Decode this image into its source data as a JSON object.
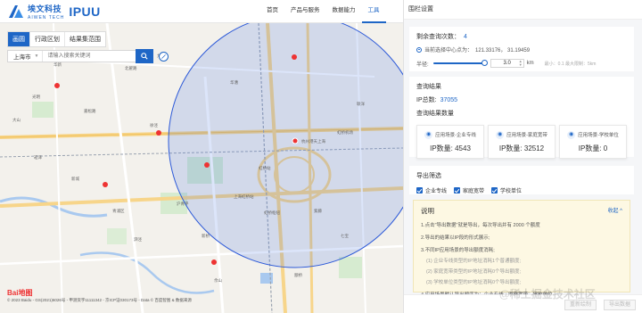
{
  "brand": {
    "name_cn": "埃文科技",
    "name_en": "AIWEN TECH",
    "product": "IPUU"
  },
  "nav": {
    "items": [
      {
        "label": "首页",
        "active": false
      },
      {
        "label": "产品与服务",
        "active": false
      },
      {
        "label": "数据能力",
        "active": false
      },
      {
        "label": "工具",
        "active": true
      }
    ]
  },
  "map": {
    "tabs": [
      "画圆",
      "行政区划",
      "结果集范围"
    ],
    "active_tab": "画圆",
    "city": "上海市",
    "search_placeholder": "请输入搜索关键词",
    "baidu_logo": "Bai",
    "baidu_logo_suffix": "地图",
    "copyright": "© 2023 Baidu - GS(2021)6026号 - 甲测资字11111342 - 京ICP证030173号 - Data © 百度智图 & 数据来源",
    "labels": [
      "九亭",
      "杭州港天上海",
      "北翟路",
      "华新",
      "光明",
      "徐泾",
      "嘉松路",
      "沪青平",
      "青浦区",
      "崧泽",
      "新城",
      "颛桥",
      "华漕",
      "大山",
      "虹桥站",
      "佘山",
      "虹桥机场",
      "紫藤",
      "七宝",
      "联洋",
      "泗泾",
      "新桥",
      "上海虹桥站",
      "虹桥枢纽"
    ]
  },
  "panel": {
    "title": "围栏设置",
    "remaining_label": "剩余查询次数：",
    "remaining_value": "4",
    "center_label": "当前选择中心点为：",
    "center_value": "121.33176， 31.19459",
    "radius_label": "半径:",
    "radius_value": "3.0",
    "radius_unit": "km",
    "radius_tip": "最小：0.1 最大限制：5km",
    "radius_fraction": 0.6,
    "result_title": "查询结果",
    "ip_total_label": "IP总数:",
    "ip_total_value": "37055",
    "result_data_label": "查询结果数量",
    "stats": [
      {
        "label": "应用场景-企业专线",
        "count_label": "IP数量:",
        "value": "4543"
      },
      {
        "label": "应用场景-家庭宽带",
        "count_label": "IP数量:",
        "value": "32512"
      },
      {
        "label": "应用场景-学校单位",
        "count_label": "IP数量:",
        "value": "0"
      }
    ],
    "export_title": "导出筛选",
    "checks": [
      "企业专线",
      "家庭宽带",
      "学校单位"
    ],
    "explain": {
      "title": "说明",
      "collapse": "收起 ^",
      "lines": [
        "1.点击\"导出数据\"就是导出，每次导出并有 2000 个额度",
        "2.导出的结果以IP段的形式展示;",
        "3.不同IP应用场景的导出额度消耗;"
      ],
      "sub_lines": [
        "(1)  企业专线类型的IP地址消耗1个普通额度;",
        "(2)  家庭宽带类型的IP地址消耗0个导出额度;",
        "(3)  学校单位类型的IP地址消耗0个导出额度;"
      ],
      "last_line": "4.应用场景默认导出顺序为：企业专线、家庭宽带、学校单位"
    },
    "footer_buttons": [
      "重新绘制",
      "导出数据"
    ]
  },
  "watermark": "@稀土掘金技术社区",
  "colors": {
    "accent": "#1e66c6",
    "circle_fill": "rgba(60,110,230,0.18)",
    "circle_stroke": "#2c59d8"
  }
}
